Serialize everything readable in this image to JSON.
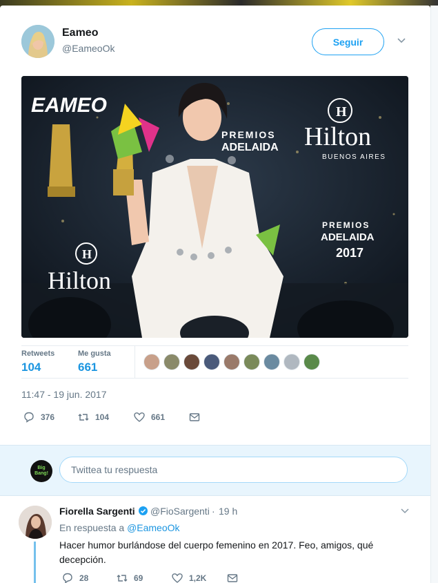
{
  "tweet": {
    "author_name": "Eameo",
    "author_handle": "@EameoOk",
    "follow_label": "Seguir",
    "image_text": {
      "brand_logo": "EAMEO",
      "sponsor": "Hilton",
      "sponsor_sub": "BUENOS AIRES",
      "event_line1": "PREMIOS",
      "event_line2": "ADELAIDA",
      "event_year": "2017"
    },
    "stats": {
      "retweets_label": "Retweets",
      "retweets_value": "104",
      "likes_label": "Me gusta",
      "likes_value": "661",
      "liker_colors": [
        "#c8a08a",
        "#8a8a6a",
        "#6a4a3a",
        "#4a5a7a",
        "#9a7a6a",
        "#7a8a5a",
        "#6a8aa0",
        "#b0b8c0",
        "#5a8a4a"
      ]
    },
    "timestamp": "11:47 - 19 jun. 2017",
    "actions": {
      "replies": "376",
      "retweets": "104",
      "likes": "661",
      "reply_icon": "reply-icon",
      "retweet_icon": "retweet-icon",
      "like_icon": "heart-icon",
      "dm_icon": "envelope-icon"
    }
  },
  "reply_box": {
    "avatar_text_1": "Big",
    "avatar_text_2": "Bang!",
    "placeholder": "Twittea tu respuesta"
  },
  "reply": {
    "author_name": "Fiorella Sargenti",
    "author_handle": "@FioSargenti",
    "separator": "·",
    "time": "19 h",
    "in_reply_prefix": "En respuesta a",
    "in_reply_handle": "@EameoOk",
    "text": "Hacer humor burlándose del cuerpo femenino en 2017. Feo, amigos, qué decepción.",
    "actions": {
      "replies": "28",
      "retweets": "69",
      "likes": "1,2K"
    }
  },
  "colors": {
    "accent": "#1da1f2",
    "link": "#1b95e0",
    "muted": "#657786",
    "reply_bg": "#e8f5fd"
  }
}
